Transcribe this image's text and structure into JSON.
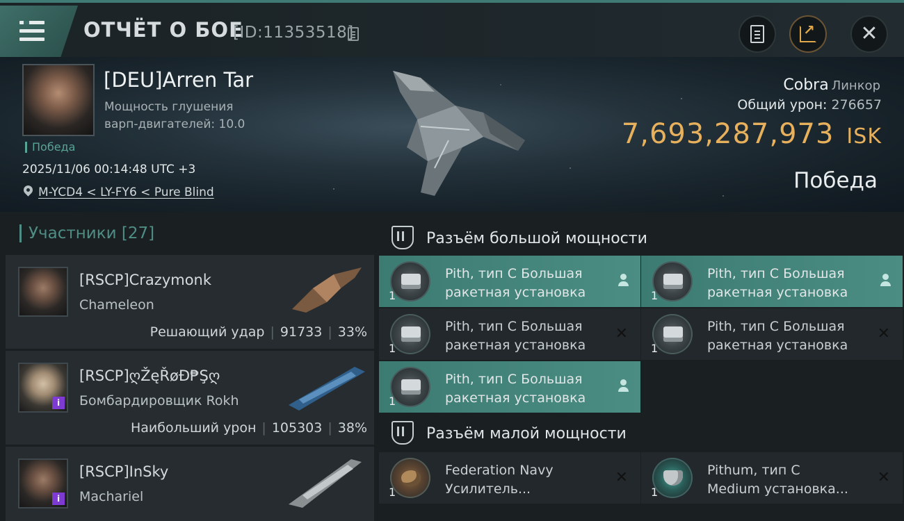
{
  "header": {
    "title": "ОТЧЁТ О БОЕ",
    "report_id": "[ID:11353518]"
  },
  "pilot": {
    "name": "[DEU]Arren Tar",
    "stat_line1": "Мощность глушения",
    "stat_line2": "варп-двигателей: 10.0",
    "tag": "Победа",
    "datetime": "2025/11/06 00:14:48 UTC +3",
    "location": "M-YCD4 < LY-FY6 < Pure Blind"
  },
  "ship": {
    "name": "Cobra",
    "class": "Линкор",
    "total_damage_label": "Общий урон:",
    "total_damage": "276657",
    "isk_value": "7,693,287,973",
    "isk_unit": "ISK",
    "result": "Победа"
  },
  "participants": {
    "heading": "Участники [27]",
    "items": [
      {
        "name": "[RSCP]Crazymonk",
        "ship": "Chameleon",
        "stat_label": "Решающий удар",
        "damage": "91733",
        "percent": "33%",
        "badge": ""
      },
      {
        "name": "[RSCP]ღŽęŘøĐ₱Şღ",
        "ship": "Бомбардировщик Rokh",
        "stat_label": "Наибольший урон",
        "damage": "105303",
        "percent": "38%",
        "badge": "i"
      },
      {
        "name": "[RSCP]InSky",
        "ship": "Machariel",
        "stat_label": "",
        "damage": "",
        "percent": "",
        "badge": "i"
      }
    ]
  },
  "modules": {
    "high_heading": "Разъём большой мощности",
    "low_heading": "Разъём малой мощности",
    "high": [
      {
        "line1": "Pith, тип C Большая",
        "line2": "ракетная установка",
        "qty": "1",
        "state": "dropped"
      },
      {
        "line1": "Pith, тип C Большая",
        "line2": "ракетная установка",
        "qty": "1",
        "state": "dropped"
      },
      {
        "line1": "Pith, тип C Большая",
        "line2": "ракетная установка",
        "qty": "1",
        "state": "destroyed"
      },
      {
        "line1": "Pith, тип C Большая",
        "line2": "ракетная установка",
        "qty": "1",
        "state": "destroyed"
      },
      {
        "line1": "Pith, тип C Большая",
        "line2": "ракетная установка",
        "qty": "1",
        "state": "dropped"
      }
    ],
    "low": [
      {
        "line1": "Federation Navy",
        "line2": "Усилитель...",
        "qty": "1",
        "state": "destroyed"
      },
      {
        "line1": "Pithum, тип C",
        "line2": "Medium установка...",
        "qty": "1",
        "state": "destroyed"
      }
    ]
  },
  "colors": {
    "accent": "#4f8d85",
    "isk": "#e7b05c",
    "dropped_bg": "#3c7b72",
    "destroyed_bg": "#22282b"
  }
}
